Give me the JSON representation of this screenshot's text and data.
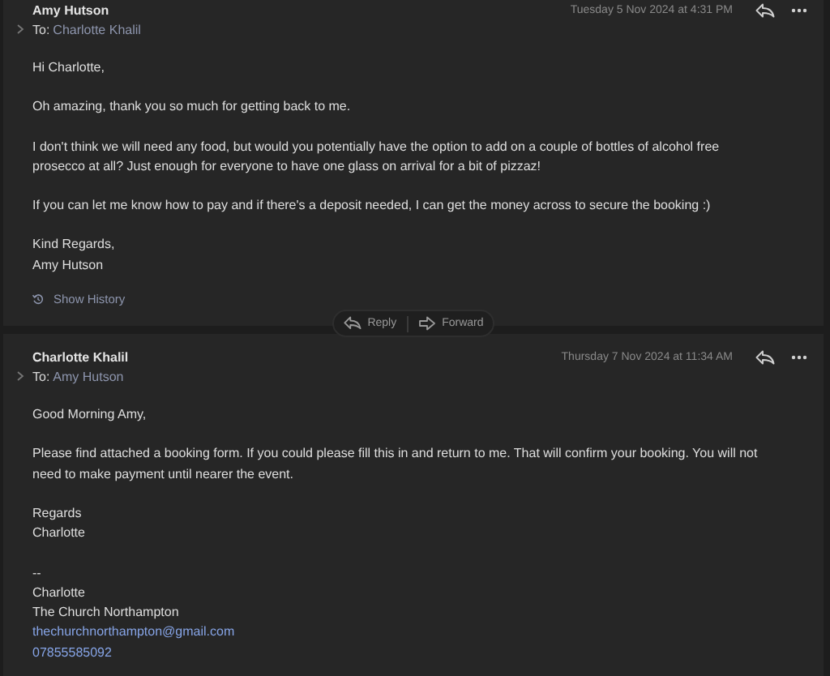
{
  "messages": [
    {
      "sender": "Amy Hutson",
      "to_label": "To:",
      "recipient": "Charlotte Khalil",
      "date": "Tuesday 5 Nov 2024 at 4:31 PM",
      "blocks": [
        [
          {
            "kind": "text",
            "text": "Hi Charlotte,"
          }
        ],
        [
          {
            "kind": "text",
            "text": "Oh amazing, thank you so much for getting back to me."
          }
        ],
        [
          {
            "kind": "text",
            "text": "I don't think we will need any food, but would you potentially have the option to add on a couple of bottles of alcohol free prosecco at all? Just enough for everyone to have one glass on arrival for a bit of pizzaz!"
          }
        ],
        [
          {
            "kind": "text",
            "text": "If you can let me know how to pay and if there's a deposit needed, I can get the money across to secure the booking :)"
          }
        ],
        [
          {
            "kind": "text",
            "text": "Kind Regards,"
          },
          {
            "kind": "text",
            "text": "Amy Hutson"
          }
        ]
      ],
      "show_history": "Show History",
      "actions": [
        "Reply",
        "Forward"
      ]
    },
    {
      "sender": "Charlotte Khalil",
      "to_label": "To:",
      "recipient": "Amy Hutson",
      "date": "Thursday 7 Nov 2024 at 11:34 AM",
      "blocks": [
        [
          {
            "kind": "text",
            "text": "Good Morning Amy,"
          }
        ],
        [
          {
            "kind": "text",
            "text": "Please find attached a booking form. If you could please fill this in and return to me. That will confirm your booking. You will not need to make payment until nearer the event."
          }
        ],
        [
          {
            "kind": "text",
            "text": "Regards"
          },
          {
            "kind": "text",
            "text": "Charlotte"
          }
        ],
        [
          {
            "kind": "text",
            "text": "--"
          },
          {
            "kind": "text",
            "text": "Charlotte"
          },
          {
            "kind": "text",
            "text": "The Church Northampton"
          },
          {
            "kind": "link",
            "text": "thechurchnorthampton@gmail.com"
          },
          {
            "kind": "link",
            "text": "07855585092"
          }
        ]
      ]
    }
  ]
}
